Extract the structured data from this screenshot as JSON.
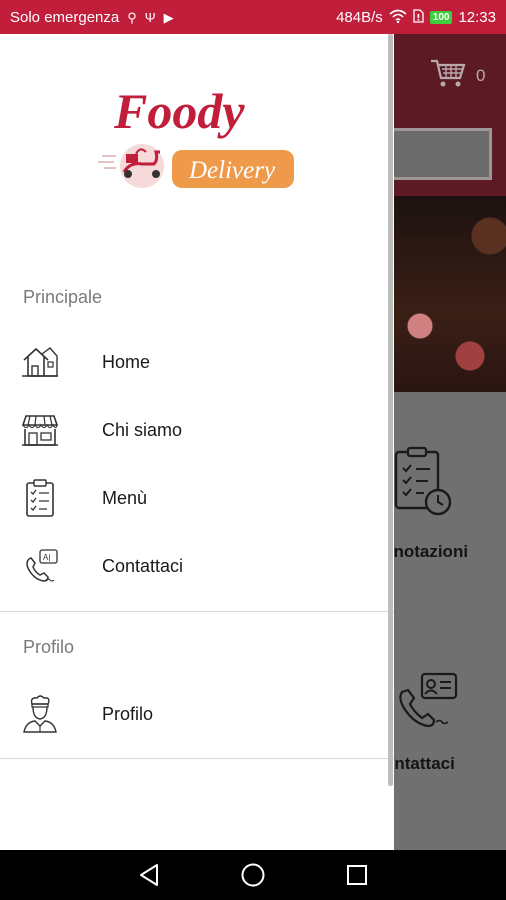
{
  "status_bar": {
    "carrier": "Solo emergenza",
    "speed": "484B/s",
    "battery": "100",
    "time": "12:33"
  },
  "background_app": {
    "cart_count": "0",
    "tile_label_1": "enotazioni",
    "tile_label_2": "ontattaci"
  },
  "drawer": {
    "logo": {
      "brand": "Foody",
      "tagline": "Delivery"
    },
    "sections": [
      {
        "title": "Principale",
        "items": [
          {
            "label": "Home",
            "icon": "house-icon"
          },
          {
            "label": "Chi siamo",
            "icon": "store-icon"
          },
          {
            "label": "Menù",
            "icon": "clipboard-icon"
          },
          {
            "label": "Contattaci",
            "icon": "phone-chat-icon"
          }
        ]
      },
      {
        "title": "Profilo",
        "items": [
          {
            "label": "Profilo",
            "icon": "chef-icon"
          }
        ]
      }
    ]
  },
  "colors": {
    "status_bar": "#c11e3c",
    "brand_red": "#c11e3c",
    "brand_orange": "#ef9a4a"
  }
}
